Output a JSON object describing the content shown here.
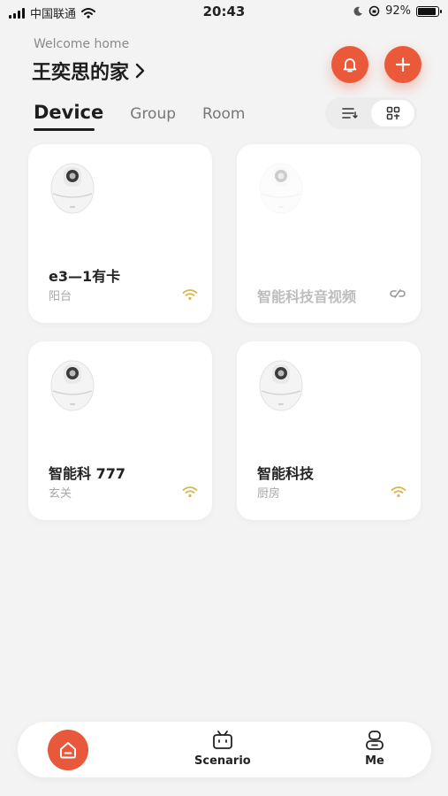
{
  "status_bar": {
    "carrier": "中国联通",
    "time": "20:43",
    "battery": "92%",
    "battery_level": 0.92
  },
  "header": {
    "welcome": "Welcome home",
    "home_name": "王奕思的家"
  },
  "tabs": [
    {
      "label": "Device",
      "active": true
    },
    {
      "label": "Group",
      "active": false
    },
    {
      "label": "Room",
      "active": false
    }
  ],
  "devices": [
    {
      "name": "e3—1有卡",
      "room": "阳台",
      "status": "online",
      "icon": "wifi-icon"
    },
    {
      "name": "智能科技音视频",
      "room": "",
      "status": "offline",
      "icon": "offline-link-icon"
    },
    {
      "name": "智能科 777",
      "room": "玄关",
      "status": "online",
      "icon": "wifi-icon"
    },
    {
      "name": "智能科技",
      "room": "厨房",
      "status": "online",
      "icon": "wifi-icon"
    }
  ],
  "bottom_nav": {
    "home_icon": "home-icon",
    "scenario": "Scenario",
    "me": "Me"
  },
  "colors": {
    "accent": "#ea5a3a",
    "wifi": "#d6b64a",
    "background": "#f3f3f3"
  }
}
